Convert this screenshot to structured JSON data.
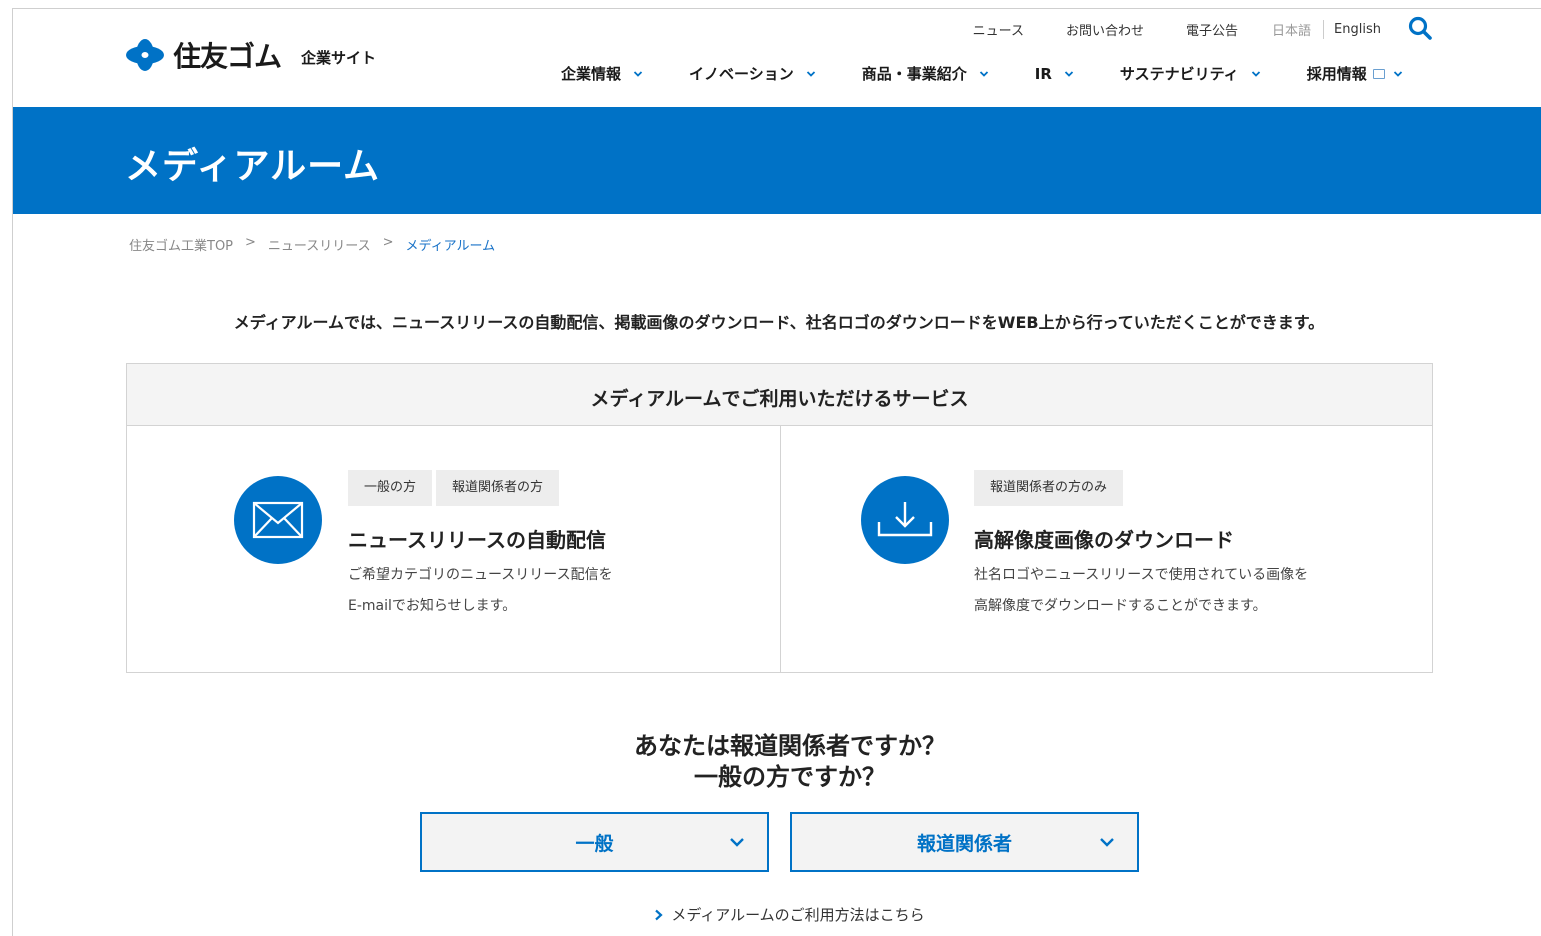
{
  "brand": {
    "name": "住友ゴム",
    "subtitle": "企業サイト",
    "color": "#0072c6"
  },
  "utility_nav": {
    "news": "ニュース",
    "contact": "お問い合わせ",
    "e_notice": "電子公告",
    "lang_ja": "日本語",
    "lang_en": "English",
    "search_icon": "search-icon"
  },
  "main_nav": [
    {
      "label": "企業情報"
    },
    {
      "label": "イノベーション"
    },
    {
      "label": "商品・事業紹介"
    },
    {
      "label": "IR"
    },
    {
      "label": "サステナビリティ"
    },
    {
      "label": "採用情報"
    }
  ],
  "hero": {
    "title": "メディアルーム"
  },
  "breadcrumb": {
    "items": [
      "住友ゴム工業TOP",
      "ニュースリリース"
    ],
    "current": "メディアルーム",
    "separator": ">"
  },
  "intro": "メディアルームでは、ニュースリリースの自動配信、掲載画像のダウンロード、社名ロゴのダウンロードをWEB上から行っていただくことができます。",
  "services": {
    "heading": "メディアルームでご利用いただけるサービス",
    "items": [
      {
        "icon": "mail-icon",
        "tags": [
          "一般の方",
          "報道関係者の方"
        ],
        "title": "ニュースリリースの自動配信",
        "description": "ご希望カテゴリのニュースリリース配信を\nE-mailでお知らせします。"
      },
      {
        "icon": "download-icon",
        "tags": [
          "報道関係者の方のみ"
        ],
        "title": "高解像度画像のダウンロード",
        "description": "社名ロゴやニュースリリースで使用されている画像を\n高解像度でダウンロードすることができます。"
      }
    ]
  },
  "question": "あなたは報道関係者ですか？\n一般の方ですか？",
  "buttons": {
    "general": "一般",
    "press": "報道関係者"
  },
  "howto_link": "メディアルームのご利用方法はこちら"
}
